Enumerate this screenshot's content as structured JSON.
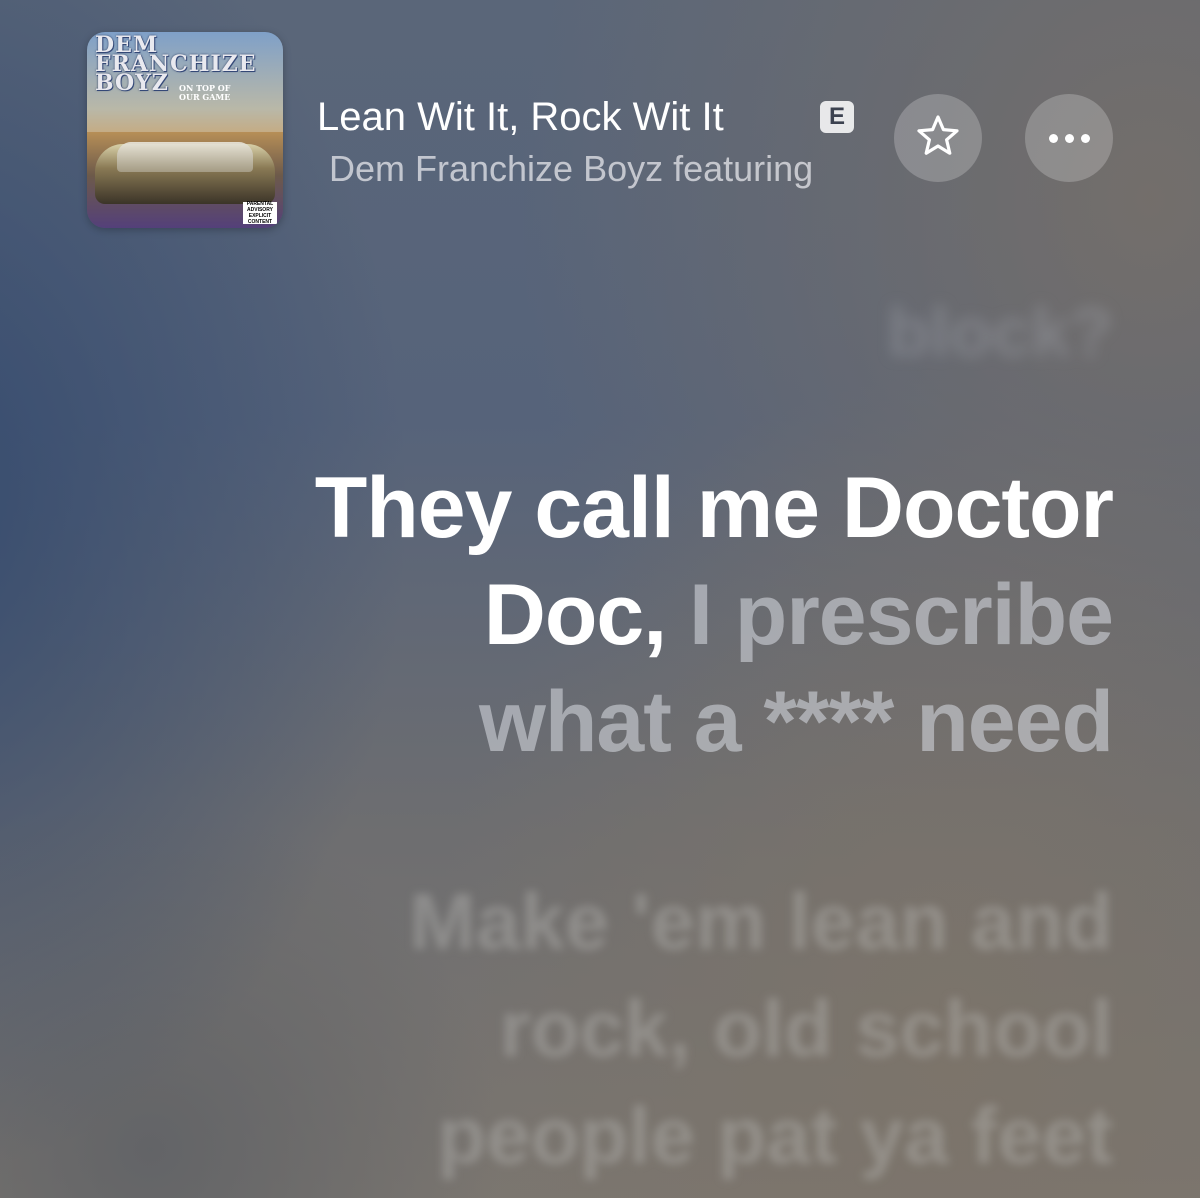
{
  "now_playing": {
    "artwork": {
      "album_title": "DEM\nFRANCHIZE\nBOYZ",
      "album_subtitle": "ON TOP OF\nOUR GAME",
      "advisory": "PARENTAL\nADVISORY\nEXPLICIT CONTENT"
    },
    "title": "Lean Wit It, Rock Wit It",
    "explicit_badge": "E",
    "artist": "Dem Franchize Boyz featuring"
  },
  "buttons": {
    "favorite_icon": "star-icon",
    "more_icon": "more-icon"
  },
  "lyrics": {
    "previous_line": "block?",
    "current": {
      "line1_sung": "They call me Doctor",
      "line2_sung": "Doc,",
      "line2_unsung": " I prescribe",
      "line3_unsung": "what a **** need"
    },
    "next_lines": [
      "Make 'em lean and",
      "rock, old school",
      "people pat ya feet"
    ]
  },
  "colors": {
    "active_lyric": "#ffffff",
    "background_blue": "#56637a",
    "background_warm": "#7b7670"
  }
}
